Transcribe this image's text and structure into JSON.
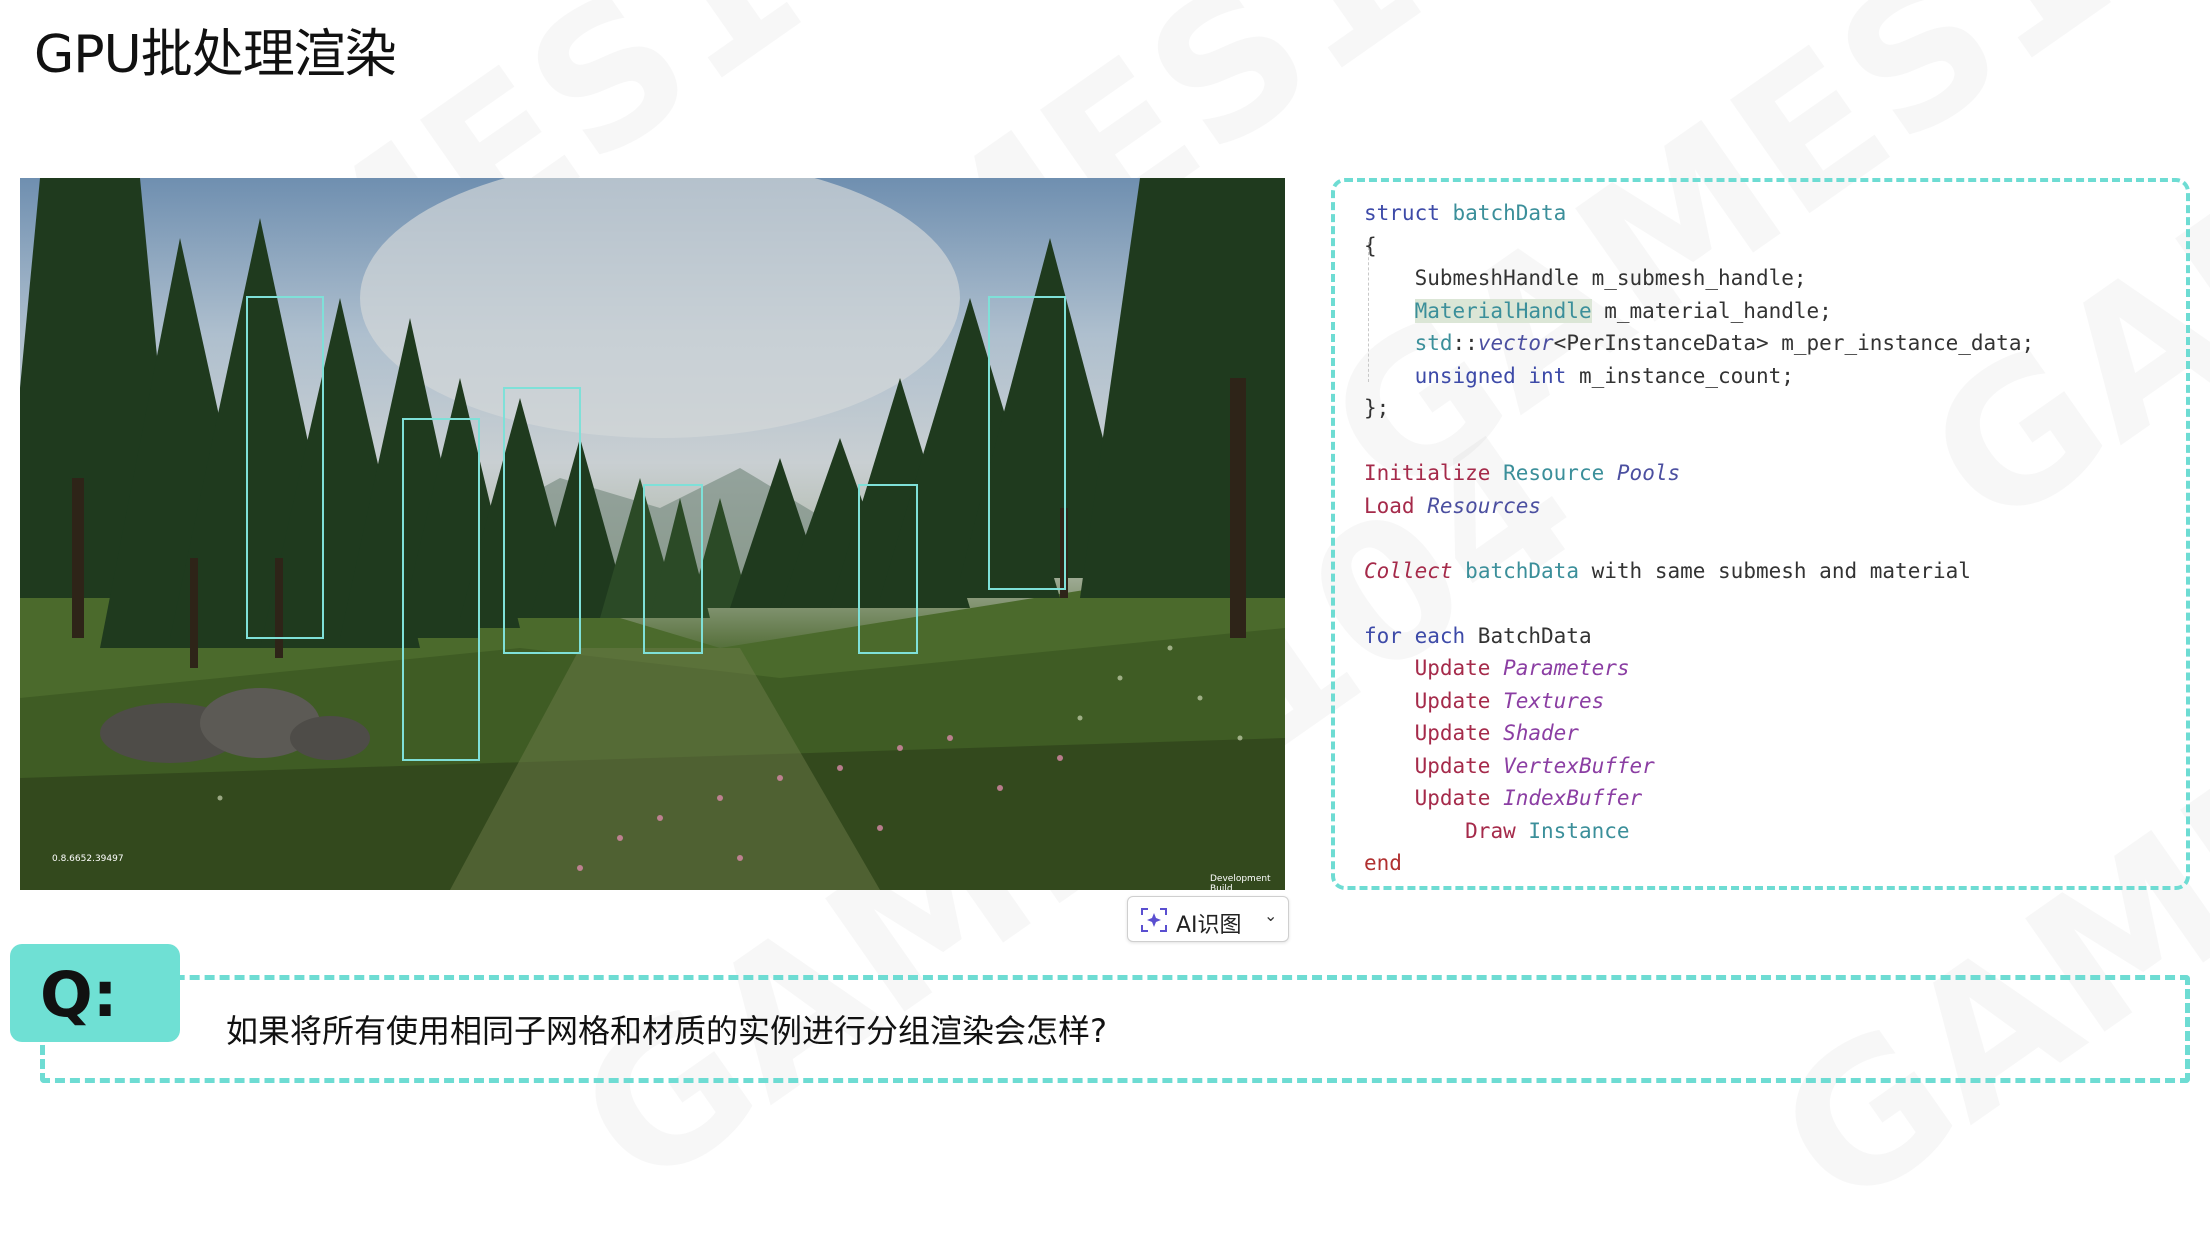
{
  "slide": {
    "title": "GPU批处理渲染",
    "watermark_text": "GAMES104"
  },
  "scene": {
    "version_text": "0.8.6652.39497",
    "build_text": "Development Build"
  },
  "code": {
    "lines": [
      "struct batchData",
      "{",
      "SubmeshHandle m_submesh_handle;",
      "MaterialHandle m_material_handle;",
      "std::vector<PerInstanceData> m_per_instance_data;",
      "unsigned int m_instance_count;",
      "};",
      "Initialize Resource Pools",
      "Load Resources",
      "Collect batchData with same submesh and material",
      "for each BatchData",
      "Update Parameters",
      "Update Textures",
      "Update Shader",
      "Update VertexBuffer",
      "Update IndexBuffer",
      "Draw Instance",
      "end"
    ]
  },
  "ai_button": {
    "label": "AI识图"
  },
  "question": {
    "badge": "Q:",
    "text": "如果将所有使用相同子网格和材质的实例进行分组渲染会怎样?"
  },
  "colors": {
    "accent": "#6edcd3",
    "keyword": "#3d4aa8",
    "function": "#a52a4a",
    "italic": "#8b3ea3"
  }
}
